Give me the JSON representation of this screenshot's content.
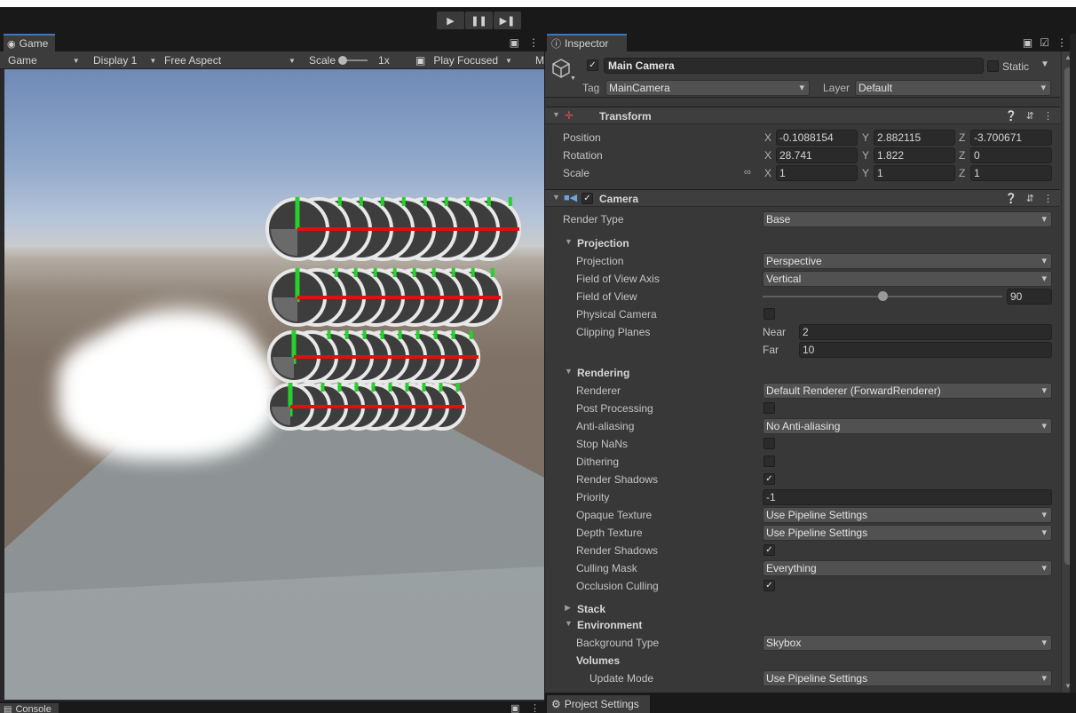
{
  "toolbar": {
    "play_icon": "play-icon",
    "pause_icon": "pause-icon",
    "step_icon": "step-icon"
  },
  "game": {
    "tab_label": "Game",
    "view_select": "Game",
    "display": "Display 1",
    "aspect": "Free Aspect",
    "scale_label": "Scale",
    "scale_value": "1x",
    "play_mode": "Play Focused",
    "overflow_label": "M"
  },
  "inspector": {
    "tab_label": "Inspector",
    "object_name": "Main Camera",
    "static_label": "Static",
    "tag_label": "Tag",
    "tag_value": "MainCamera",
    "layer_label": "Layer",
    "layer_value": "Default"
  },
  "transform": {
    "title": "Transform",
    "position_label": "Position",
    "rotation_label": "Rotation",
    "scale_label": "Scale",
    "position": {
      "x": "-0.1088154",
      "y": "2.882115",
      "z": "-3.700671"
    },
    "rotation": {
      "x": "28.741",
      "y": "1.822",
      "z": "0"
    },
    "scale": {
      "x": "1",
      "y": "1",
      "z": "1"
    },
    "axis_x": "X",
    "axis_y": "Y",
    "axis_z": "Z"
  },
  "camera": {
    "title": "Camera",
    "render_type_label": "Render Type",
    "render_type": "Base",
    "projection_section": "Projection",
    "projection_label": "Projection",
    "projection": "Perspective",
    "fov_axis_label": "Field of View Axis",
    "fov_axis": "Vertical",
    "fov_label": "Field of View",
    "fov_value": "90",
    "fov_fraction": 0.5,
    "physical_label": "Physical Camera",
    "clipping_label": "Clipping Planes",
    "near_label": "Near",
    "near": "2",
    "far_label": "Far",
    "far": "10",
    "rendering_section": "Rendering",
    "renderer_label": "Renderer",
    "renderer": "Default Renderer (ForwardRenderer)",
    "post_label": "Post Processing",
    "aa_label": "Anti-aliasing",
    "aa": "No Anti-aliasing",
    "stopnans_label": "Stop NaNs",
    "dithering_label": "Dithering",
    "render_shadows_label": "Render Shadows",
    "priority_label": "Priority",
    "priority": "-1",
    "opaque_label": "Opaque Texture",
    "opaque": "Use Pipeline Settings",
    "depth_label": "Depth Texture",
    "depth": "Use Pipeline Settings",
    "render_shadows2_label": "Render Shadows",
    "culling_label": "Culling Mask",
    "culling": "Everything",
    "occlusion_label": "Occlusion Culling",
    "stack_section": "Stack",
    "environment_section": "Environment",
    "bg_type_label": "Background Type",
    "bg_type": "Skybox",
    "volumes_label": "Volumes",
    "update_mode_label": "Update Mode",
    "update_mode": "Use Pipeline Settings"
  },
  "bottom": {
    "console_tab": "Console",
    "project_settings_tab": "Project Settings"
  }
}
